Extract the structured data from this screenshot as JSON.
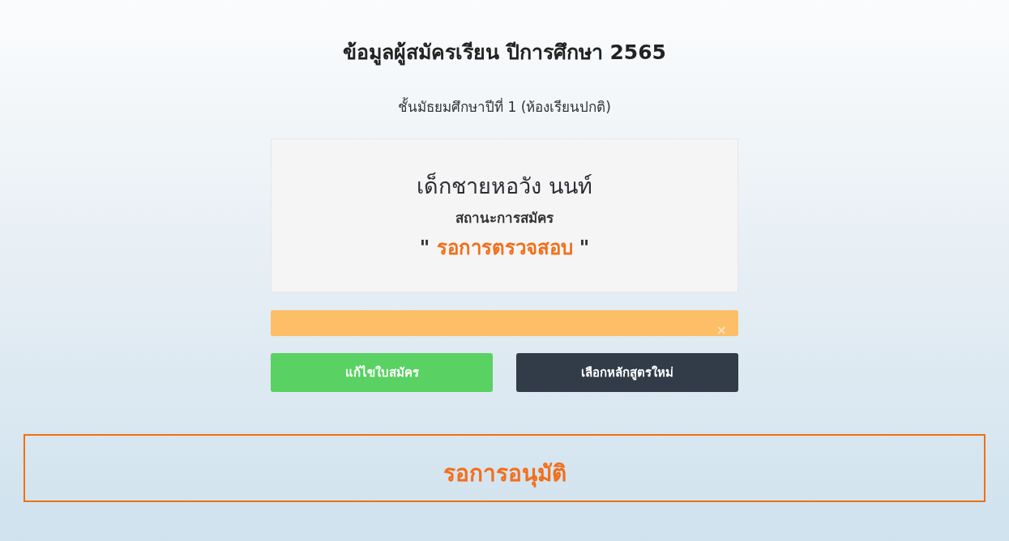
{
  "title": "ข้อมูลผู้สมัครเรียน ปีการศึกษา 2565",
  "subtitle": "ชั้นมัธยมศึกษาปีที่ 1 (ห้องเรียนปกติ)",
  "card": {
    "name": "เด็กชายหอวัง นนท์",
    "status_label": "สถานะการสมัคร",
    "status_value": "รอการตรวจสอบ",
    "quote": "\""
  },
  "alert": {
    "close": "×"
  },
  "buttons": [
    {
      "label": "แก้ไขใบสมัคร",
      "kind": "edit"
    },
    {
      "label": "เลือกหลักสูตรใหม่",
      "kind": "choose"
    }
  ],
  "approval": {
    "text": "รอการอนุมัติ"
  }
}
